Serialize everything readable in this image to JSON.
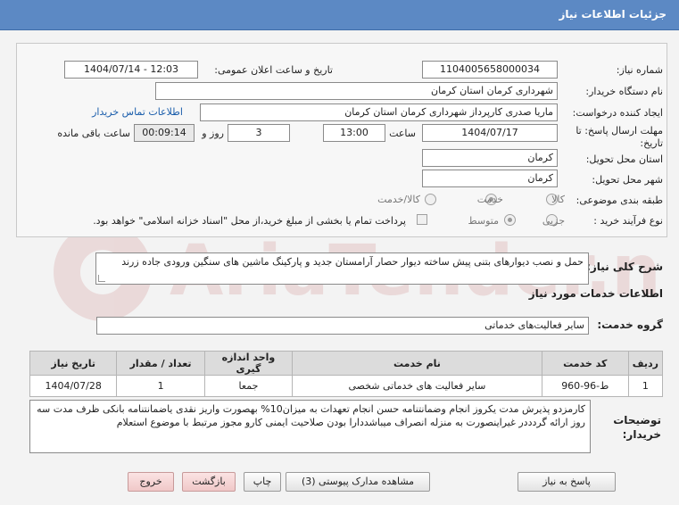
{
  "header": {
    "title": "جزئیات اطلاعات نیاز"
  },
  "form": {
    "need_number_label": "شماره نیاز:",
    "need_number": "1104005658000034",
    "announce_label": "تاریخ و ساعت اعلان عمومی:",
    "announce_value": "1404/07/14 - 12:03",
    "buyer_org_label": "نام دستگاه خریدار:",
    "buyer_org": "شهرداری کرمان استان کرمان",
    "creator_label": "ایجاد کننده درخواست:",
    "creator": "ماریا صدری کارپرداز شهرداری کرمان استان کرمان",
    "contact_link": "اطلاعات تماس خریدار",
    "deadline_label_1": "مهلت ارسال پاسخ: تا",
    "deadline_label_2": "تاریخ:",
    "deadline_date": "1404/07/17",
    "time_label": "ساعت",
    "deadline_time": "13:00",
    "days_value": "3",
    "days_label": "روز و",
    "remaining_time": "00:09:14",
    "remaining_label": "ساعت باقی مانده",
    "province_label": "استان محل تحویل:",
    "province": "کرمان",
    "city_label": "شهر محل تحویل:",
    "city": "کرمان",
    "category_label": "طبقه بندی موضوعی:",
    "category_options": [
      "کالا",
      "خدمت",
      "کالا/خدمت"
    ],
    "category_selected": "خدمت",
    "process_label": "نوع فرآیند خرید :",
    "process_options": [
      "جزیی",
      "متوسط"
    ],
    "process_selected": "متوسط",
    "payment_note": "پرداخت تمام یا بخشی از مبلغ خرید،از محل \"اسناد خزانه اسلامی\" خواهد بود."
  },
  "description": {
    "label": "شرح کلی نیاز:",
    "text": "حمل و نصب دیوارهای بتنی پیش ساخته دیوار حصار آرامستان جدید و پارکینگ ماشین های سنگین ورودی جاده زرند"
  },
  "services": {
    "section_title": "اطلاعات خدمات مورد نیاز",
    "group_label": "گروه خدمت:",
    "group_value": "سایر فعالیت‌های خدماتی",
    "columns": [
      "ردیف",
      "کد خدمت",
      "نام خدمت",
      "واحد اندازه گیری",
      "تعداد / مقدار",
      "تاریخ نیاز"
    ],
    "rows": [
      [
        "1",
        "ط-96-960",
        "سایر فعالیت های خدماتی شخصی",
        "جمعا",
        "1",
        "1404/07/28"
      ]
    ]
  },
  "buyer_notes": {
    "label_1": "توضیحات",
    "label_2": "خریدار:",
    "text": "کارمزدو پذیرش مدت یکروز انجام وضمانتنامه حسن انجام تعهدات به میزان10% بهصورت واریز نقدی یاضمانتنامه بانکی ظرف مدت سه روز ارائه گردددر غیراینصورت به منزله انصراف میباشددارا بودن صلاحیت ایمنی کارو مجوز مرتبط با موضوع استعلام"
  },
  "buttons": {
    "reply": "پاسخ به نیاز",
    "attachments": "مشاهده مدارک پیوستی (3)",
    "print": "چاپ",
    "back": "بازگشت",
    "exit": "خروج"
  },
  "watermark": {
    "text": "AriaTender.net"
  },
  "colors": {
    "header": "#5c89c4",
    "link": "#1a5dab",
    "watermark": "#e8c4c4"
  }
}
